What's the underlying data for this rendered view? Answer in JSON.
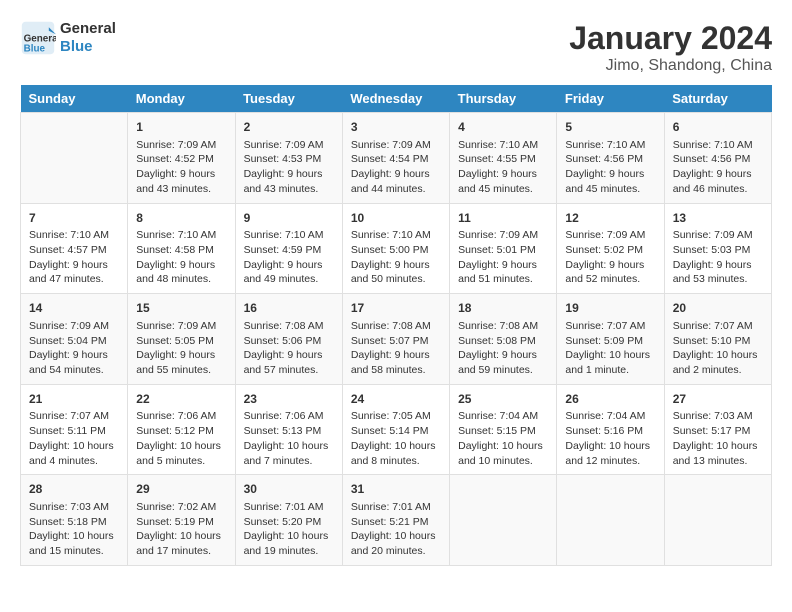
{
  "header": {
    "logo_general": "General",
    "logo_blue": "Blue",
    "title": "January 2024",
    "subtitle": "Jimo, Shandong, China"
  },
  "days_of_week": [
    "Sunday",
    "Monday",
    "Tuesday",
    "Wednesday",
    "Thursday",
    "Friday",
    "Saturday"
  ],
  "weeks": [
    [
      {
        "day": "",
        "content": ""
      },
      {
        "day": "1",
        "content": "Sunrise: 7:09 AM\nSunset: 4:52 PM\nDaylight: 9 hours\nand 43 minutes."
      },
      {
        "day": "2",
        "content": "Sunrise: 7:09 AM\nSunset: 4:53 PM\nDaylight: 9 hours\nand 43 minutes."
      },
      {
        "day": "3",
        "content": "Sunrise: 7:09 AM\nSunset: 4:54 PM\nDaylight: 9 hours\nand 44 minutes."
      },
      {
        "day": "4",
        "content": "Sunrise: 7:10 AM\nSunset: 4:55 PM\nDaylight: 9 hours\nand 45 minutes."
      },
      {
        "day": "5",
        "content": "Sunrise: 7:10 AM\nSunset: 4:56 PM\nDaylight: 9 hours\nand 45 minutes."
      },
      {
        "day": "6",
        "content": "Sunrise: 7:10 AM\nSunset: 4:56 PM\nDaylight: 9 hours\nand 46 minutes."
      }
    ],
    [
      {
        "day": "7",
        "content": "Sunrise: 7:10 AM\nSunset: 4:57 PM\nDaylight: 9 hours\nand 47 minutes."
      },
      {
        "day": "8",
        "content": "Sunrise: 7:10 AM\nSunset: 4:58 PM\nDaylight: 9 hours\nand 48 minutes."
      },
      {
        "day": "9",
        "content": "Sunrise: 7:10 AM\nSunset: 4:59 PM\nDaylight: 9 hours\nand 49 minutes."
      },
      {
        "day": "10",
        "content": "Sunrise: 7:10 AM\nSunset: 5:00 PM\nDaylight: 9 hours\nand 50 minutes."
      },
      {
        "day": "11",
        "content": "Sunrise: 7:09 AM\nSunset: 5:01 PM\nDaylight: 9 hours\nand 51 minutes."
      },
      {
        "day": "12",
        "content": "Sunrise: 7:09 AM\nSunset: 5:02 PM\nDaylight: 9 hours\nand 52 minutes."
      },
      {
        "day": "13",
        "content": "Sunrise: 7:09 AM\nSunset: 5:03 PM\nDaylight: 9 hours\nand 53 minutes."
      }
    ],
    [
      {
        "day": "14",
        "content": "Sunrise: 7:09 AM\nSunset: 5:04 PM\nDaylight: 9 hours\nand 54 minutes."
      },
      {
        "day": "15",
        "content": "Sunrise: 7:09 AM\nSunset: 5:05 PM\nDaylight: 9 hours\nand 55 minutes."
      },
      {
        "day": "16",
        "content": "Sunrise: 7:08 AM\nSunset: 5:06 PM\nDaylight: 9 hours\nand 57 minutes."
      },
      {
        "day": "17",
        "content": "Sunrise: 7:08 AM\nSunset: 5:07 PM\nDaylight: 9 hours\nand 58 minutes."
      },
      {
        "day": "18",
        "content": "Sunrise: 7:08 AM\nSunset: 5:08 PM\nDaylight: 9 hours\nand 59 minutes."
      },
      {
        "day": "19",
        "content": "Sunrise: 7:07 AM\nSunset: 5:09 PM\nDaylight: 10 hours\nand 1 minute."
      },
      {
        "day": "20",
        "content": "Sunrise: 7:07 AM\nSunset: 5:10 PM\nDaylight: 10 hours\nand 2 minutes."
      }
    ],
    [
      {
        "day": "21",
        "content": "Sunrise: 7:07 AM\nSunset: 5:11 PM\nDaylight: 10 hours\nand 4 minutes."
      },
      {
        "day": "22",
        "content": "Sunrise: 7:06 AM\nSunset: 5:12 PM\nDaylight: 10 hours\nand 5 minutes."
      },
      {
        "day": "23",
        "content": "Sunrise: 7:06 AM\nSunset: 5:13 PM\nDaylight: 10 hours\nand 7 minutes."
      },
      {
        "day": "24",
        "content": "Sunrise: 7:05 AM\nSunset: 5:14 PM\nDaylight: 10 hours\nand 8 minutes."
      },
      {
        "day": "25",
        "content": "Sunrise: 7:04 AM\nSunset: 5:15 PM\nDaylight: 10 hours\nand 10 minutes."
      },
      {
        "day": "26",
        "content": "Sunrise: 7:04 AM\nSunset: 5:16 PM\nDaylight: 10 hours\nand 12 minutes."
      },
      {
        "day": "27",
        "content": "Sunrise: 7:03 AM\nSunset: 5:17 PM\nDaylight: 10 hours\nand 13 minutes."
      }
    ],
    [
      {
        "day": "28",
        "content": "Sunrise: 7:03 AM\nSunset: 5:18 PM\nDaylight: 10 hours\nand 15 minutes."
      },
      {
        "day": "29",
        "content": "Sunrise: 7:02 AM\nSunset: 5:19 PM\nDaylight: 10 hours\nand 17 minutes."
      },
      {
        "day": "30",
        "content": "Sunrise: 7:01 AM\nSunset: 5:20 PM\nDaylight: 10 hours\nand 19 minutes."
      },
      {
        "day": "31",
        "content": "Sunrise: 7:01 AM\nSunset: 5:21 PM\nDaylight: 10 hours\nand 20 minutes."
      },
      {
        "day": "",
        "content": ""
      },
      {
        "day": "",
        "content": ""
      },
      {
        "day": "",
        "content": ""
      }
    ]
  ]
}
